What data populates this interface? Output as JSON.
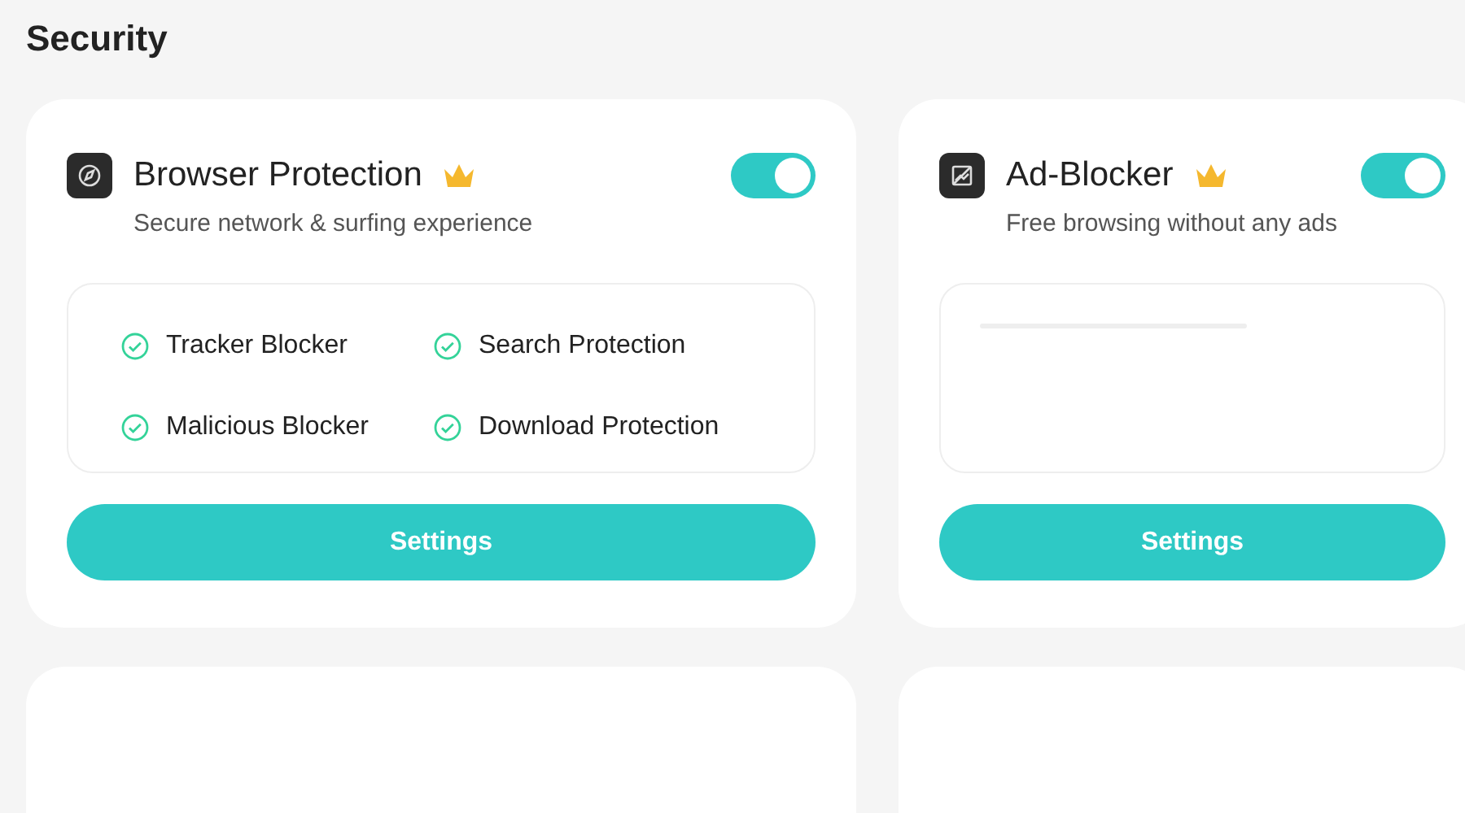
{
  "section_title": "Security",
  "cards": [
    {
      "kind": "features",
      "title": "Browser Protection",
      "premium": true,
      "on": true,
      "subtitle": "Secure network & surfing experience",
      "features": [
        "Tracker Blocker",
        "Search Protection",
        "Malicious Blocker",
        "Download Protection"
      ],
      "button": "Settings"
    },
    {
      "kind": "loading",
      "title": "Ad-Blocker",
      "premium": true,
      "on": true,
      "subtitle": "Free browsing without any ads",
      "button": "Settings"
    }
  ]
}
